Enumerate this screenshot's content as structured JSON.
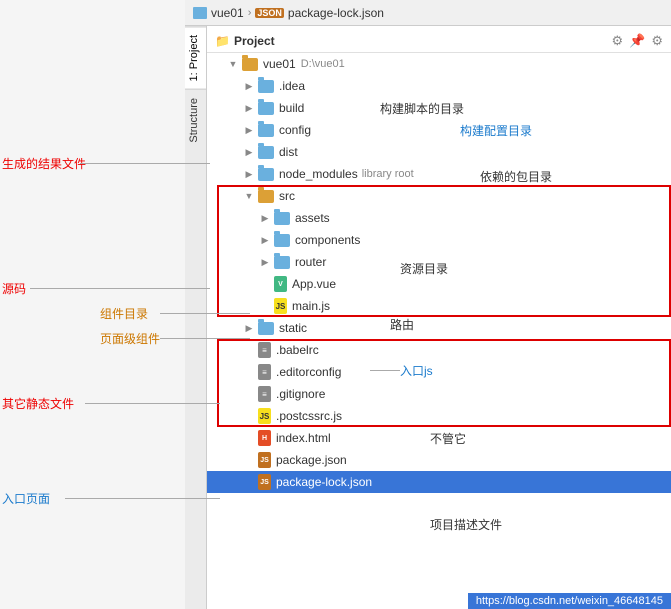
{
  "breadcrumb": {
    "project": "vue01",
    "sep1": "›",
    "file": "package-lock.json"
  },
  "header": {
    "project_label": "Project",
    "icons": [
      "⚙",
      "⊕",
      "⚙"
    ]
  },
  "tree": {
    "root_label": "vue01",
    "root_path": "D:\\vue01",
    "items": [
      {
        "id": "idea",
        "indent": 2,
        "type": "folder",
        "name": ".idea",
        "annotation": ""
      },
      {
        "id": "build",
        "indent": 2,
        "type": "folder",
        "name": "build",
        "annotation": "构建脚本的目录"
      },
      {
        "id": "config",
        "indent": 2,
        "type": "folder",
        "name": "config",
        "annotation": "构建配置目录"
      },
      {
        "id": "dist",
        "indent": 2,
        "type": "folder",
        "name": "dist",
        "annotation": ""
      },
      {
        "id": "node_modules",
        "indent": 2,
        "type": "folder",
        "name": "node_modules",
        "badge": "library root",
        "annotation": "依赖的包目录"
      },
      {
        "id": "src",
        "indent": 2,
        "type": "folder",
        "name": "src",
        "annotation": ""
      },
      {
        "id": "assets",
        "indent": 3,
        "type": "folder",
        "name": "assets",
        "annotation": "资源目录"
      },
      {
        "id": "components",
        "indent": 3,
        "type": "folder",
        "name": "components",
        "annotation": ""
      },
      {
        "id": "router",
        "indent": 3,
        "type": "folder",
        "name": "router",
        "annotation": "路由"
      },
      {
        "id": "app_vue",
        "indent": 3,
        "type": "vue",
        "name": "App.vue",
        "annotation": ""
      },
      {
        "id": "main_js",
        "indent": 3,
        "type": "js",
        "name": "main.js",
        "annotation": "入口js"
      },
      {
        "id": "static",
        "indent": 2,
        "type": "folder",
        "name": "static",
        "annotation": ""
      },
      {
        "id": "babelrc",
        "indent": 2,
        "type": "generic",
        "name": ".babelrc",
        "annotation": ""
      },
      {
        "id": "editorconfig",
        "indent": 2,
        "type": "generic",
        "name": ".editorconfig",
        "annotation": "不管它"
      },
      {
        "id": "gitignore",
        "indent": 2,
        "type": "generic",
        "name": ".gitignore",
        "annotation": ""
      },
      {
        "id": "postcssrc",
        "indent": 2,
        "type": "js",
        "name": ".postcssrc.js",
        "annotation": ""
      },
      {
        "id": "index_html",
        "indent": 2,
        "type": "html",
        "name": "index.html",
        "annotation": ""
      },
      {
        "id": "package_json",
        "indent": 2,
        "type": "json",
        "name": "package.json",
        "annotation": "项目描述文件"
      },
      {
        "id": "package_lock_json",
        "indent": 2,
        "type": "json",
        "name": "package-lock.json",
        "annotation": "",
        "selected": true
      }
    ]
  },
  "annotations": {
    "generated_files": "生成的结果文件",
    "source": "源码",
    "component_dir": "组件目录",
    "page_component": "页面级组件",
    "other_static": "其它静态文件",
    "entry_page": "入口页面",
    "build_script_dir": "构建脚本的目录",
    "build_config_dir": "构建配置目录",
    "dep_dir": "依赖的包目录",
    "resource_dir": "资源目录",
    "route": "路由",
    "entry_js": "入口js",
    "ignore_it": "不管它",
    "project_desc": "项目描述文件"
  },
  "watermark": "https://blog.csdn.net/weixin_46648145"
}
